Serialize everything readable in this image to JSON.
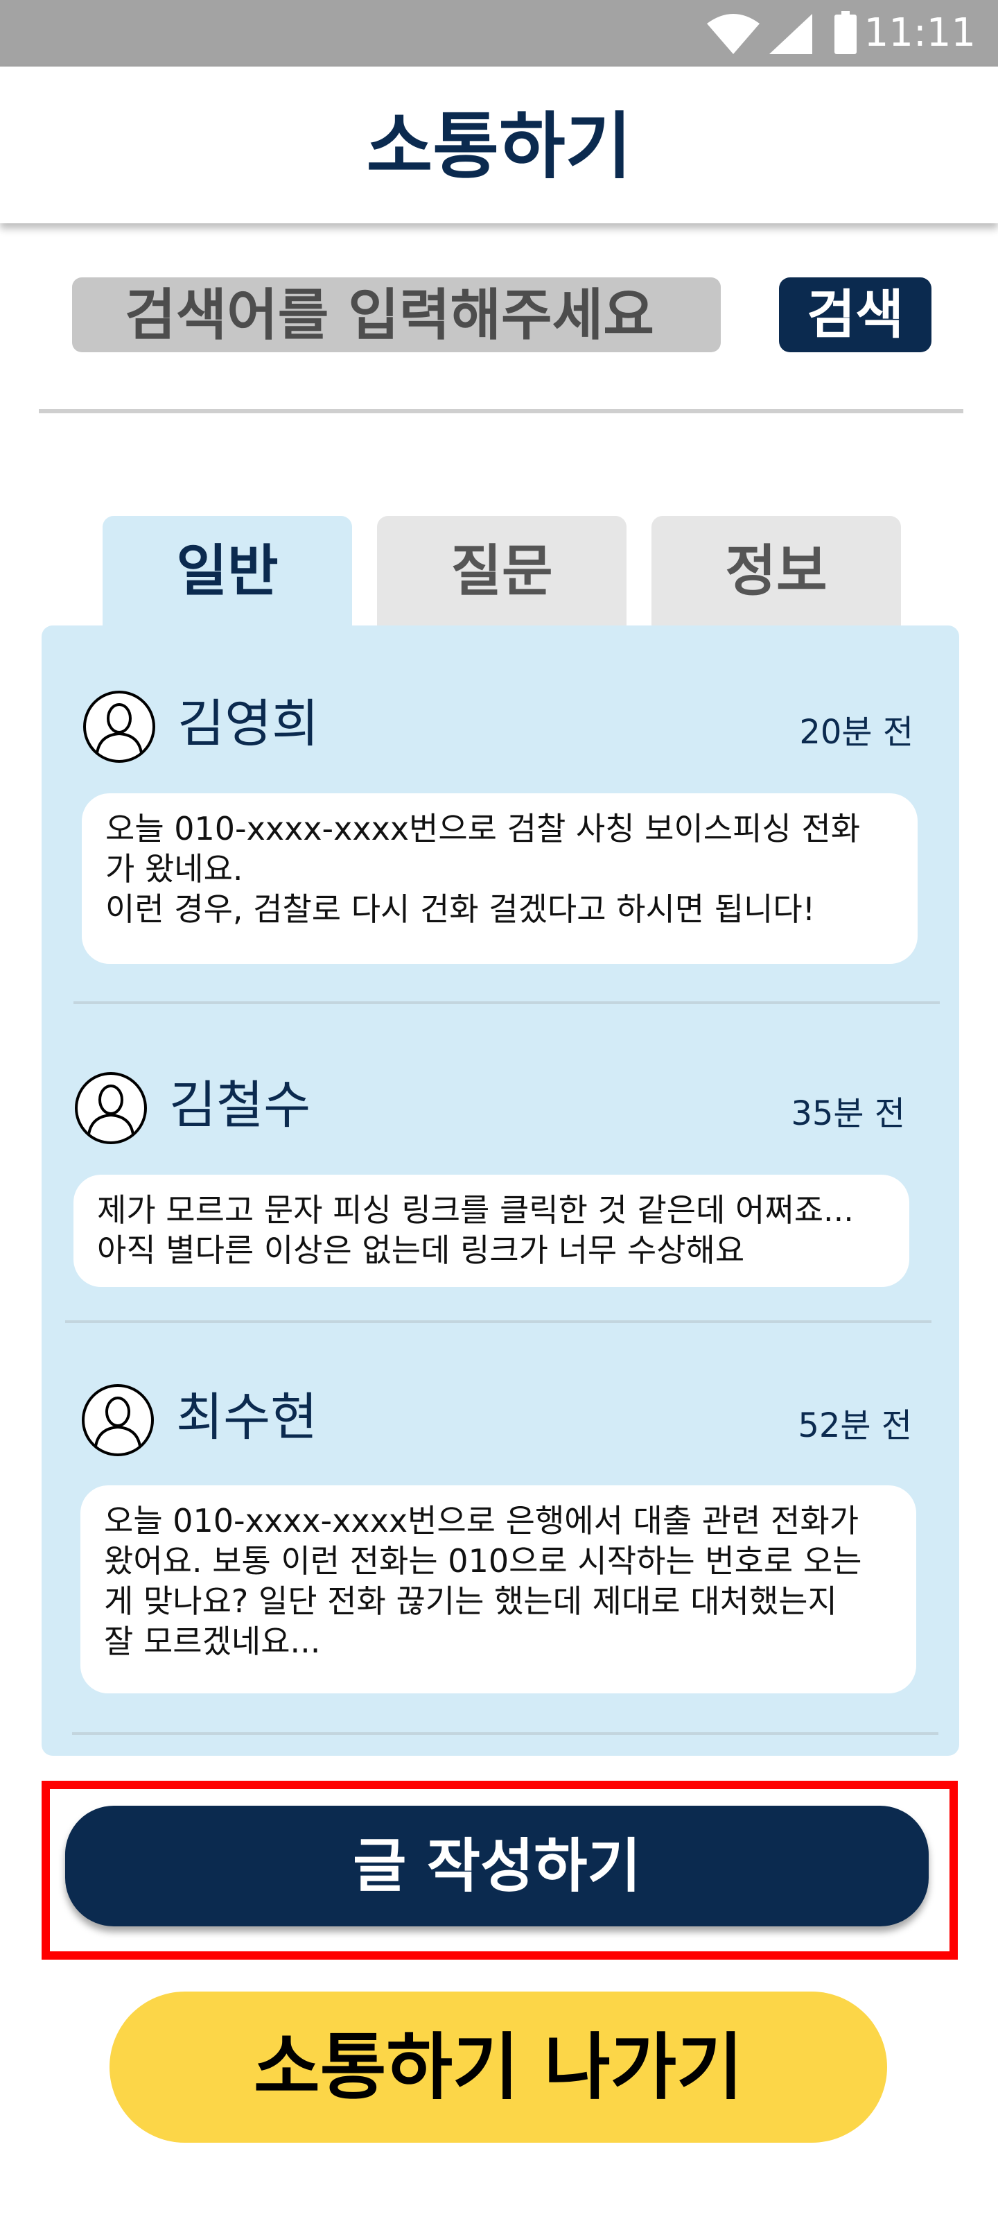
{
  "status_bar": {
    "time": "11:11",
    "icons": [
      "wifi-icon",
      "signal-icon",
      "battery-icon"
    ]
  },
  "header": {
    "title": "소통하기"
  },
  "search": {
    "placeholder": "검색어를 입력해주세요",
    "button_label": "검색"
  },
  "tabs": [
    {
      "label": "일반",
      "active": true
    },
    {
      "label": "질문",
      "active": false
    },
    {
      "label": "정보",
      "active": false
    }
  ],
  "posts": [
    {
      "author": "김영희",
      "time": "20분 전",
      "lines": [
        "오늘 010-xxxx-xxxx번으로 검찰 사칭 보이스피싱 전화",
        "가 왔네요.",
        "이런 경우, 검찰로 다시 건화 걸겠다고 하시면 됩니다!"
      ]
    },
    {
      "author": "김철수",
      "time": "35분 전",
      "lines": [
        "제가 모르고 문자 피싱 링크를 클릭한 것 같은데 어쩌죠...",
        "아직 별다른 이상은 없는데 링크가 너무 수상해요"
      ]
    },
    {
      "author": "최수현",
      "time": "52분 전",
      "lines": [
        "오늘 010-xxxx-xxxx번으로 은행에서 대출 관련 전화가",
        "왔어요. 보통 이런 전화는 010으로 시작하는 번호로 오는",
        "게 맞나요? 일단 전화 끊기는 했는데 제대로 대처했는지",
        "잘 모르겠네요..."
      ]
    }
  ],
  "actions": {
    "write_label": "글 작성하기",
    "exit_label": "소통하기 나가기"
  },
  "colors": {
    "navy": "#0b2a4f",
    "light_blue": "#d3ebf7",
    "yellow": "#fcd648",
    "highlight": "#ff0000"
  }
}
